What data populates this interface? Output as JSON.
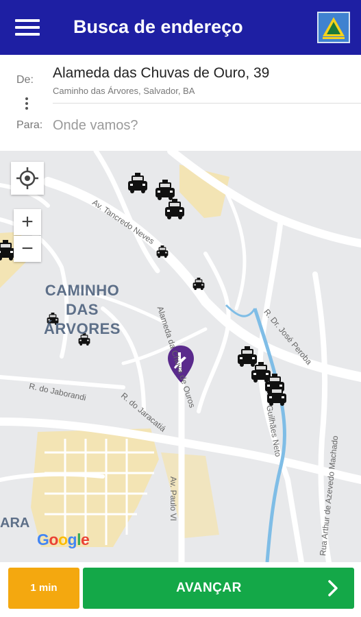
{
  "header": {
    "title": "Busca de endereço",
    "menu_icon": "hamburger-menu-icon",
    "logo_icon": "app-logo-icon"
  },
  "address": {
    "from_label": "De:",
    "from_main": "Alameda das Chuvas de Ouro, 39",
    "from_sub": "Caminho das Árvores, Salvador, BA",
    "to_label": "Para:",
    "to_placeholder": "Onde vamos?",
    "to_value": ""
  },
  "map": {
    "district_line1": "CAMINHO",
    "district_line2": "DAS ÁRVORES",
    "partial_label": "ARA",
    "streets": {
      "tancredo": "Av. Tancredo Neves",
      "alameda": "Alameda da Chuva de Ouros",
      "jose_peroba": "R. Dr. José Peroba",
      "jaborandi": "R. do Jaborandi",
      "jaracatia": "R. do Jaracatiá",
      "paulo_vi": "Av. Paulo VI",
      "guilhermes": "Guilhães Neto",
      "azevedo": "Rua Arthur de Azevedo Machado"
    },
    "google": "Google",
    "controls": {
      "locate_icon": "crosshair-icon",
      "zoom_in": "+",
      "zoom_out": "−"
    },
    "colors": {
      "water": "#7fbde6",
      "highlight": "#f3e4b4",
      "marker": "#5a2a8c"
    }
  },
  "footer": {
    "eta": "1 min",
    "action": "AVANÇAR",
    "action_icon": "chevron-right-icon"
  }
}
